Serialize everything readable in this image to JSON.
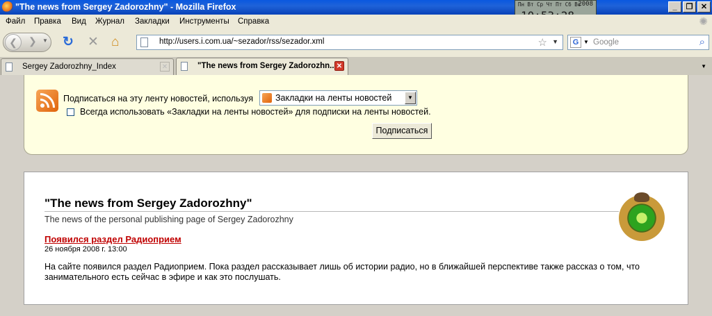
{
  "window": {
    "title": "\"The news from Sergey Zadorozhny\" - Mozilla Firefox"
  },
  "clock": {
    "days": "Пн Вт Ср Чт Пт Сб Вс",
    "year": "2008",
    "time": "10:53:28, 05. 12"
  },
  "menu": [
    "Файл",
    "Правка",
    "Вид",
    "Журнал",
    "Закладки",
    "Инструменты",
    "Справка"
  ],
  "nav": {
    "url": "http://users.i.com.ua/~sezador/rss/sezador.xml",
    "search_placeholder": "Google",
    "search_engine": "G"
  },
  "tabs": [
    {
      "label": "Sergey Zadorozhny_Index",
      "active": false
    },
    {
      "label": "\"The news from Sergey Zadorozhn...",
      "active": true
    }
  ],
  "subscribe": {
    "label": "Подписаться на эту ленту новостей, используя",
    "reader": "Закладки на ленты новостей",
    "always_label": "Всегда использовать «Закладки на ленты новостей» для подписки на ленты новостей.",
    "always_checked": false,
    "button": "Подписаться"
  },
  "feed": {
    "title": "\"The news from Sergey Zadorozhny\"",
    "subtitle": "The news of the personal publishing page of Sergey Zadorozhny",
    "items": [
      {
        "title": "Появился раздел Радиоприем",
        "date": "26 ноября 2008 г. 13:00",
        "text": "На сайте появился раздел Радиоприем. Пока раздел рассказывает лишь об истории радио, но в ближайшей перспективе также рассказ о том, что занимательного есть сейчас в эфире и как это послушать."
      }
    ]
  },
  "colors": {
    "titlebar": "#0a58e0",
    "feed_banner": "#ffffe1",
    "link": "#c00000"
  }
}
